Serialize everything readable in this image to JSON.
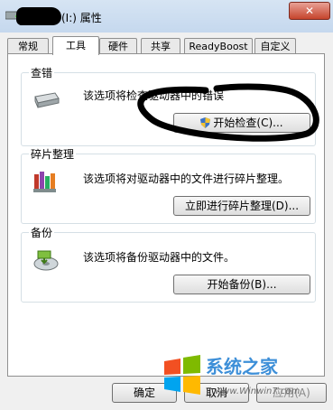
{
  "window": {
    "title_suffix": "(I:) 属性",
    "close_glyph": "✕"
  },
  "tabs": [
    {
      "label": "常规"
    },
    {
      "label": "工具"
    },
    {
      "label": "硬件"
    },
    {
      "label": "共享"
    },
    {
      "label": "ReadyBoost"
    },
    {
      "label": "自定义"
    }
  ],
  "active_tab": "工具",
  "groups": {
    "error_check": {
      "title": "查错",
      "description": "该选项将检查驱动器中的错误",
      "button_label": "开始检查(C)...",
      "icon": "drive-icon"
    },
    "defrag": {
      "title": "碎片整理",
      "description": "该选项将对驱动器中的文件进行碎片整理。",
      "button_label": "立即进行碎片整理(D)...",
      "icon": "defrag-icon"
    },
    "backup": {
      "title": "备份",
      "description": "该选项将备份驱动器中的文件。",
      "button_label": "开始备份(B)...",
      "icon": "backup-icon"
    }
  },
  "footer": {
    "ok_label": "确定",
    "cancel_label": "取消",
    "apply_label": "应用(A)"
  },
  "watermark": {
    "site_name": "系统之家",
    "url": "www.Winwin7.com"
  },
  "colors": {
    "titlebar": "#c5d8ee",
    "close": "#c6442c",
    "accent": "#3d8fd8"
  }
}
